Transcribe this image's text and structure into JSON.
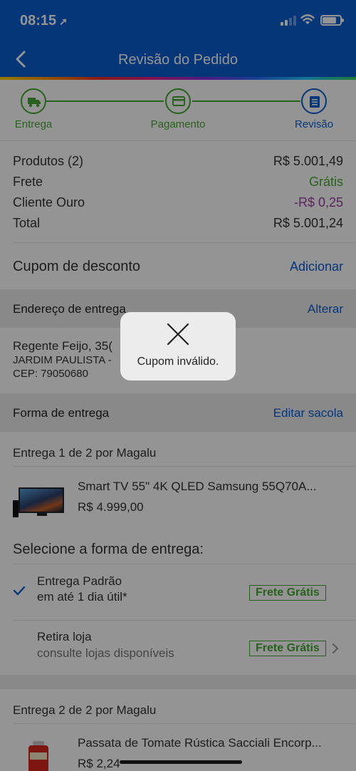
{
  "status_bar": {
    "time": "08:15"
  },
  "header": {
    "title": "Revisão do Pedido"
  },
  "steps": [
    {
      "label": "Entrega"
    },
    {
      "label": "Pagamento"
    },
    {
      "label": "Revisão"
    }
  ],
  "summary": {
    "products_label": "Produtos (2)",
    "products_value": "R$ 5.001,49",
    "shipping_label": "Frete",
    "shipping_value": "Grátis",
    "gold_label": "Cliente Ouro",
    "gold_value": "-R$ 0,25",
    "total_label": "Total",
    "total_value": "R$ 5.001,24"
  },
  "coupon": {
    "label": "Cupom de desconto",
    "action": "Adicionar"
  },
  "address": {
    "header": "Endereço de entrega",
    "action": "Alterar",
    "street": "Regente Feijo, 35(",
    "district": "JARDIM PAULISTA -",
    "cep": "CEP: 79050680"
  },
  "delivery": {
    "header": "Forma de entrega",
    "action": "Editar sacola"
  },
  "shipment1": {
    "title": "Entrega 1 de 2 por Magalu",
    "product_name": "Smart TV 55\" 4K QLED Samsung 55Q70A...",
    "product_price": "R$ 4.999,00",
    "select_title": "Selecione a forma de entrega:",
    "option1_title": "Entrega Padrão",
    "option1_sub": "em até 1 dia útil*",
    "option1_badge": "Frete Grátis",
    "option2_title": "Retira loja",
    "option2_sub": "consulte lojas disponíveis",
    "option2_badge": "Frete Grátis"
  },
  "shipment2": {
    "title": "Entrega 2 de 2 por Magalu",
    "product_name": "Passata de Tomate Rústica Sacciali Encorp...",
    "product_price": "R$ 2,24"
  },
  "toast": {
    "message": "Cupom inválido."
  },
  "colors": {
    "brand": "#0a5fcf",
    "green": "#46a832",
    "purple": "#9c3fa6"
  }
}
